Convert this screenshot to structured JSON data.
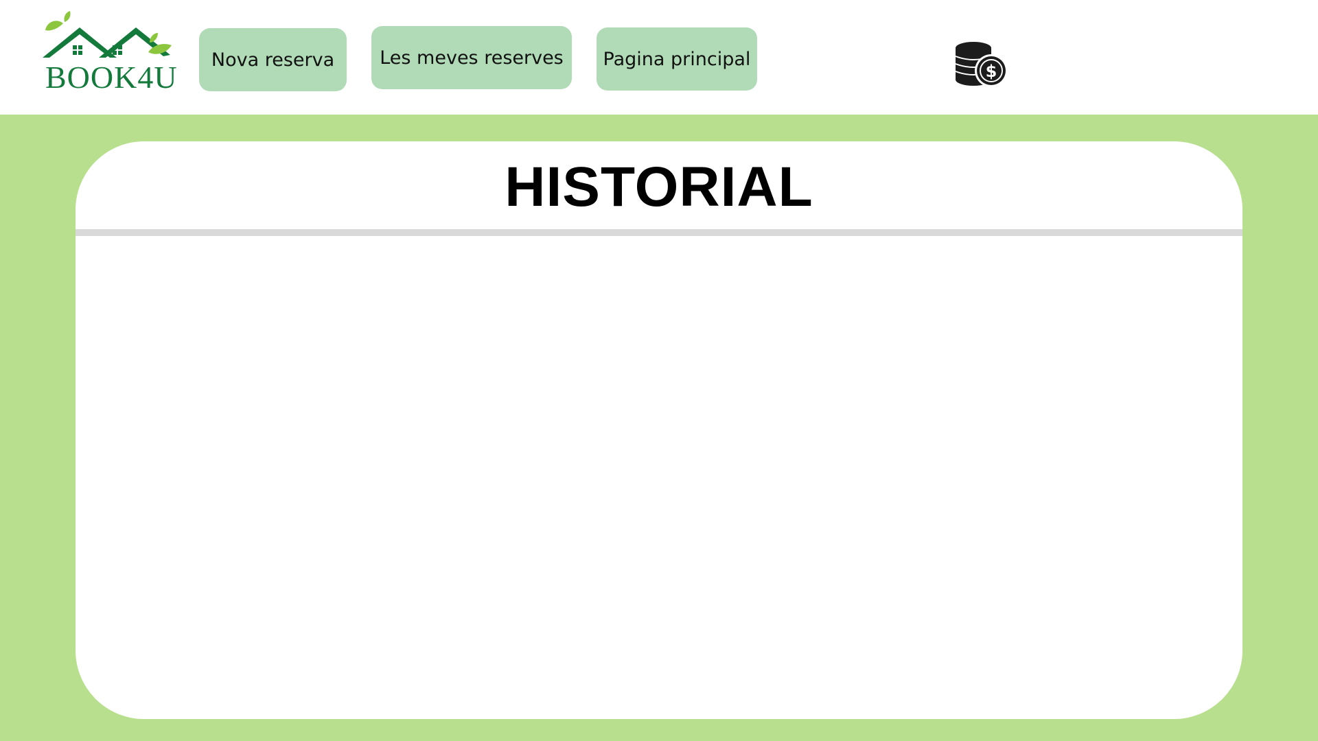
{
  "header": {
    "logo_text": "BOOK4U",
    "nav": [
      {
        "label": "Nova reserva"
      },
      {
        "label": "Les meves reserves"
      },
      {
        "label": "Pagina principal"
      }
    ],
    "coins_icon": "coins-dollar-icon"
  },
  "main": {
    "title": "HISTORIAL",
    "history_items": []
  },
  "colors": {
    "brand_green": "#137a3c",
    "leaf_green": "#8cc63f",
    "nav_button": "#b0dbb6",
    "background_green": "#b8df8d",
    "card": "#ffffff",
    "divider": "#d9d9d9"
  }
}
